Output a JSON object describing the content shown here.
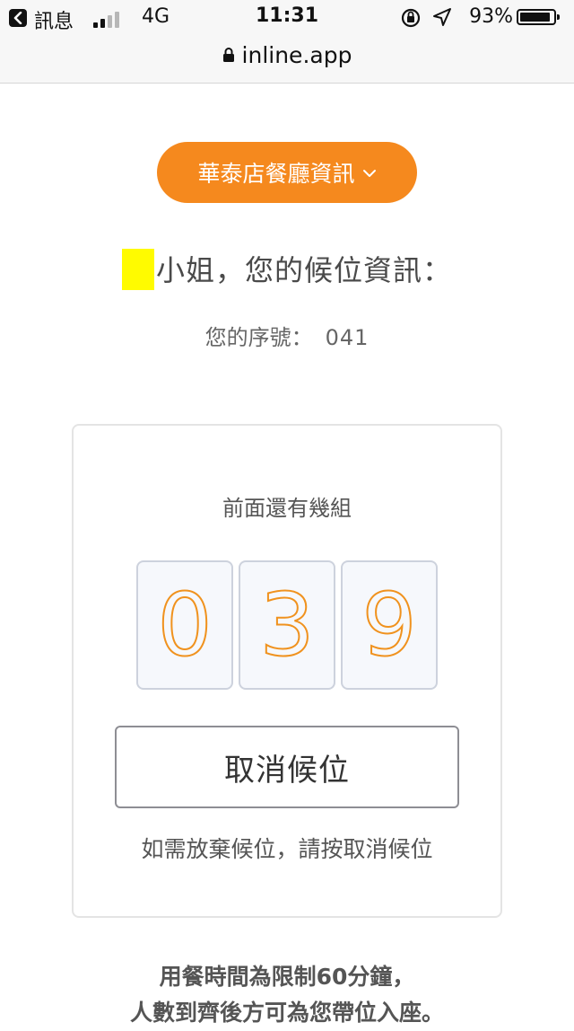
{
  "status_bar": {
    "back_app": "訊息",
    "network": "4G",
    "time": "11:31",
    "battery_percent": "93%",
    "battery_level": 0.93,
    "signal_bars_active": 2,
    "signal_bars_total": 4
  },
  "browser": {
    "url": "inline.app"
  },
  "header": {
    "restaurant_button": "華泰店餐廳資訊"
  },
  "greeting": {
    "text": "小姐，您的候位資訊："
  },
  "ticket": {
    "serial_label": "您的序號：",
    "serial_number": "041"
  },
  "queue": {
    "groups_ahead_label": "前面還有幾組",
    "digits": [
      "0",
      "3",
      "9"
    ]
  },
  "actions": {
    "cancel_button": "取消候位",
    "cancel_hint": "如需放棄候位，請按取消候位"
  },
  "notice": {
    "line1": "用餐時間為限制60分鐘，",
    "line2": "人數到齊後方可為您帶位入座。"
  },
  "colors": {
    "accent": "#f5891e",
    "digit_stroke": "#f0921e",
    "highlight": "#fffb00"
  }
}
